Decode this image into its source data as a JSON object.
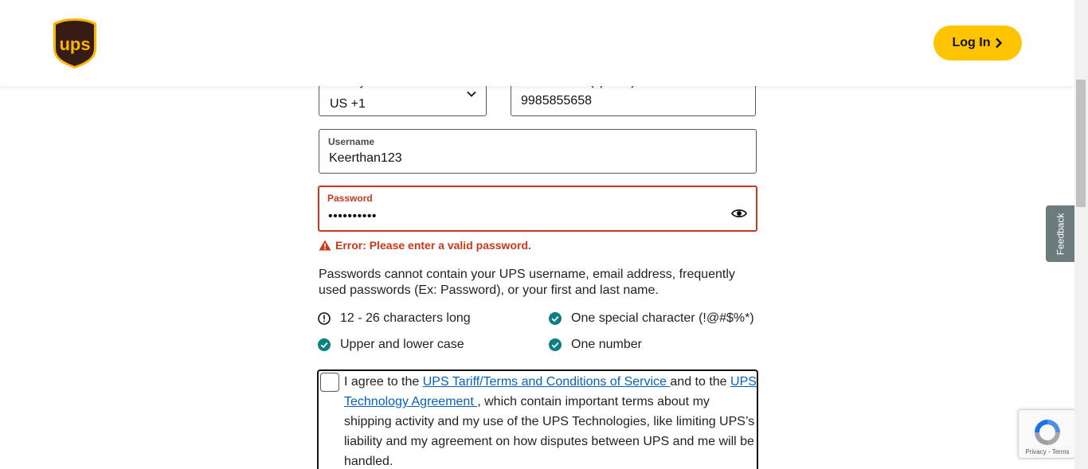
{
  "header": {
    "logo_text": "ups",
    "login_label": "Log In"
  },
  "form": {
    "country": {
      "label": "Country Code",
      "value": "US +1"
    },
    "phone": {
      "label": "Phone Number (optional)",
      "value": "9985855658"
    },
    "username": {
      "label": "Username",
      "value": "Keerthan123"
    },
    "password": {
      "label": "Password",
      "value": "••••••••••"
    },
    "error": "Error: Please enter a valid password.",
    "note": "Passwords cannot contain your UPS username, email address, frequently used passwords (Ex: Password), or your first and last name.",
    "requirements": {
      "length": "12 - 26 characters long",
      "special": "One special character (!@#$%*)",
      "case": "Upper and lower case",
      "number": "One number"
    },
    "agreement": {
      "text1": "I agree to the ",
      "link1": "UPS Tariff/Terms and Conditions of Service ",
      "text2": "and to the ",
      "link2": "UPS Technology Agreement ",
      "text3": ", which contain important terms about my shipping activity and my use of the UPS Technologies, like limiting UPS’s liability and my agreement on how disputes between UPS and me will be handled."
    }
  },
  "feedback_label": "Feedback",
  "recaptcha": {
    "links": "Privacy - Terms"
  },
  "colors": {
    "brand_brown": "#351c15",
    "brand_gold": "#ffc400",
    "error_red": "#c9381b",
    "success_teal": "#0a8080",
    "link_blue": "#0662bb"
  }
}
